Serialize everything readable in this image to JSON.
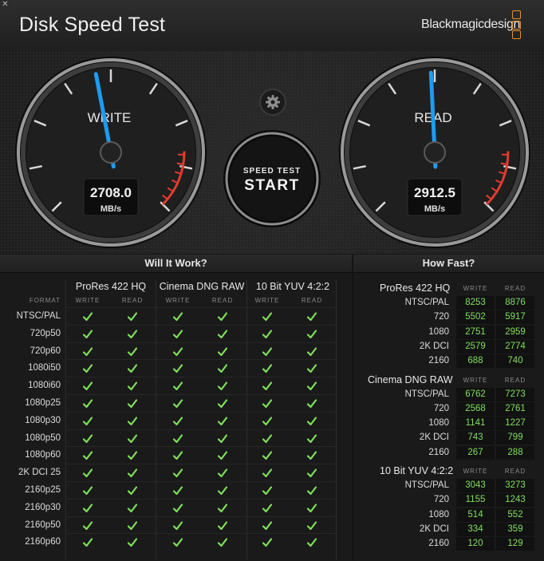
{
  "window": {
    "close_glyph": "✕"
  },
  "header": {
    "title": "Disk Speed Test",
    "brand": "Blackmagicdesign"
  },
  "colors": {
    "accent_blue": "#1d9bf0",
    "check_green": "#7fe05a",
    "value_green": "#7fe05a",
    "redline": "#e23b2e",
    "brand_orange": "#e8902c"
  },
  "gauges": {
    "write": {
      "label": "WRITE",
      "value": "2708.0",
      "unit": "MB/s",
      "needle_fraction": 0.46
    },
    "read": {
      "label": "READ",
      "value": "2912.5",
      "unit": "MB/s",
      "needle_fraction": 0.49
    }
  },
  "start_button": {
    "line1": "SPEED TEST",
    "line2": "START"
  },
  "settings": {
    "icon": "gear-icon"
  },
  "will_it_work": {
    "title": "Will It Work?",
    "format_header": "FORMAT",
    "groups": [
      {
        "name": "ProRes 422 HQ",
        "write": "WRITE",
        "read": "READ"
      },
      {
        "name": "Cinema DNG RAW",
        "write": "WRITE",
        "read": "READ"
      },
      {
        "name": "10 Bit YUV 4:2:2",
        "write": "WRITE",
        "read": "READ"
      }
    ],
    "formats": [
      "NTSC/PAL",
      "720p50",
      "720p60",
      "1080i50",
      "1080i60",
      "1080p25",
      "1080p30",
      "1080p50",
      "1080p60",
      "2K DCI 25",
      "2160p25",
      "2160p30",
      "2160p50",
      "2160p60"
    ],
    "check_glyph": "✓"
  },
  "how_fast": {
    "title": "How Fast?",
    "groups": [
      {
        "name": "ProRes 422 HQ",
        "write": "WRITE",
        "read": "READ",
        "rows": [
          [
            "NTSC/PAL",
            "8253",
            "8876"
          ],
          [
            "720",
            "5502",
            "5917"
          ],
          [
            "1080",
            "2751",
            "2959"
          ],
          [
            "2K DCI",
            "2579",
            "2774"
          ],
          [
            "2160",
            "688",
            "740"
          ]
        ]
      },
      {
        "name": "Cinema DNG RAW",
        "write": "WRITE",
        "read": "READ",
        "rows": [
          [
            "NTSC/PAL",
            "6762",
            "7273"
          ],
          [
            "720",
            "2568",
            "2761"
          ],
          [
            "1080",
            "1141",
            "1227"
          ],
          [
            "2K DCI",
            "743",
            "799"
          ],
          [
            "2160",
            "267",
            "288"
          ]
        ]
      },
      {
        "name": "10 Bit YUV 4:2:2",
        "write": "WRITE",
        "read": "READ",
        "rows": [
          [
            "NTSC/PAL",
            "3043",
            "3273"
          ],
          [
            "720",
            "1155",
            "1243"
          ],
          [
            "1080",
            "514",
            "552"
          ],
          [
            "2K DCI",
            "334",
            "359"
          ],
          [
            "2160",
            "120",
            "129"
          ]
        ]
      }
    ]
  }
}
